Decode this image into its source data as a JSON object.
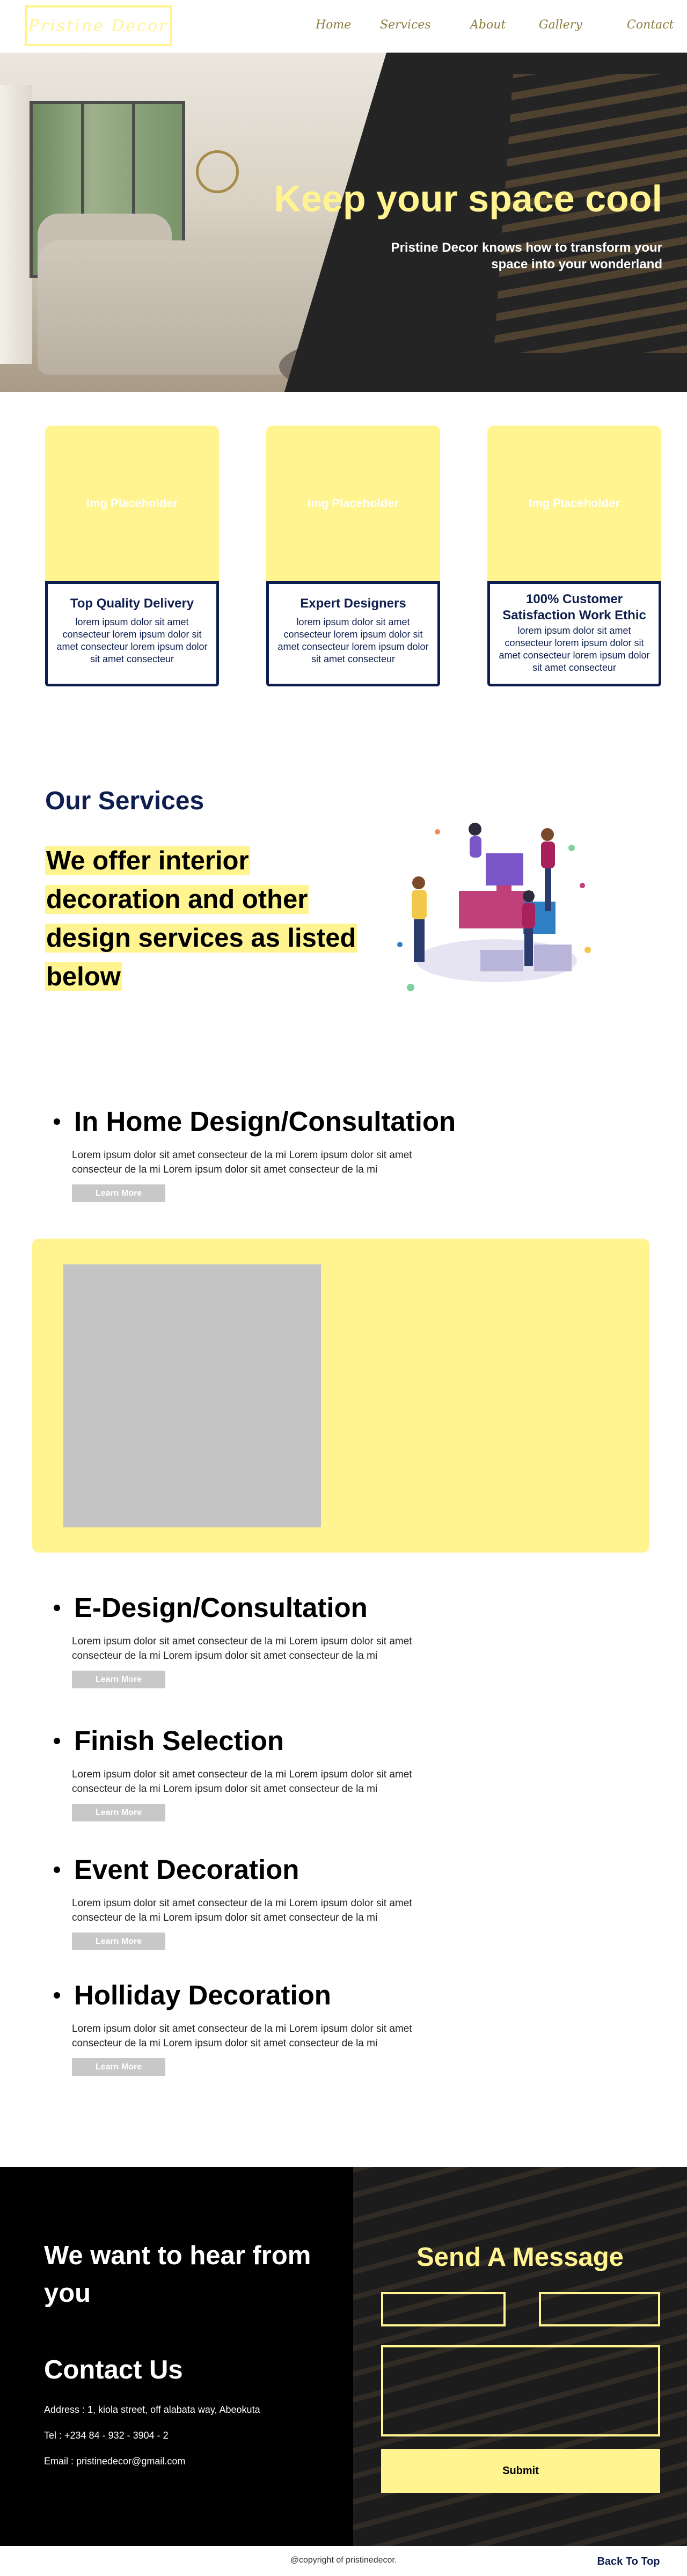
{
  "nav": {
    "logo": "Pristine Decor",
    "links": [
      "Home",
      "Services",
      "About",
      "Gallery",
      "Contact"
    ]
  },
  "hero": {
    "title": "Keep your space cool",
    "subtitle": "Pristine Decor knows how to transform your space into your wonderland"
  },
  "features": [
    {
      "placeholder": "Img Placeholder",
      "title": "Top Quality Delivery",
      "text": "lorem ipsum dolor sit amet consecteur lorem ipsum dolor sit amet consecteur lorem ipsum dolor sit amet consecteur"
    },
    {
      "placeholder": "Img Placeholder",
      "title": "Expert Designers",
      "text": "lorem ipsum dolor sit amet consecteur lorem ipsum dolor sit amet consecteur lorem ipsum dolor sit amet consecteur"
    },
    {
      "placeholder": "Img Placeholder",
      "title": "100% Customer Satisfaction Work Ethic",
      "text": "lorem ipsum dolor sit amet consecteur lorem ipsum dolor sit amet consecteur lorem ipsum dolor sit amet consecteur"
    }
  ],
  "services_intro": {
    "title": "Our Services",
    "lead": "We offer interior decoration and other design services as listed below"
  },
  "services": [
    {
      "title": "In Home Design/Consultation",
      "text": "Lorem ipsum dolor sit amet consecteur de la mi Lorem ipsum dolor sit amet consecteur de la mi Lorem ipsum dolor sit amet consecteur de la mi",
      "button": "Learn More"
    },
    {
      "title": "E-Design/Consultation",
      "text": "Lorem ipsum dolor sit amet consecteur de la mi Lorem ipsum dolor sit amet consecteur de la mi Lorem ipsum dolor sit amet consecteur de la mi",
      "button": "Learn More"
    },
    {
      "title": "Finish Selection",
      "text": "Lorem ipsum dolor sit amet consecteur de la mi Lorem ipsum dolor sit amet consecteur de la mi Lorem ipsum dolor sit amet consecteur de la mi",
      "button": "Learn More"
    },
    {
      "title": "Event Decoration",
      "text": "Lorem ipsum dolor sit amet consecteur de la mi Lorem ipsum dolor sit amet consecteur de la mi Lorem ipsum dolor sit amet consecteur de la mi",
      "button": "Learn More"
    },
    {
      "title": "Holliday Decoration",
      "text": "Lorem ipsum dolor sit amet consecteur de la mi Lorem ipsum dolor sit amet consecteur de la mi Lorem ipsum dolor sit amet consecteur de la mi",
      "button": "Learn More"
    }
  ],
  "contact": {
    "hear": "We want to hear from you",
    "title": "Contact Us",
    "address": "Address : 1, kiola street, off alabata way, Abeokuta",
    "tel": "Tel : +234 84 - 932 - 3904 - 2",
    "email": "Email : pristinedecor@gmail.com",
    "form_title": "Send A Message",
    "submit": "Submit"
  },
  "footer": {
    "copyright": "@copyright of pristinedecor.",
    "back_to_top": "Back To Top"
  },
  "colors": {
    "accent_yellow": "#fff48f",
    "navy": "#0e1f4f",
    "dark": "#000000"
  }
}
